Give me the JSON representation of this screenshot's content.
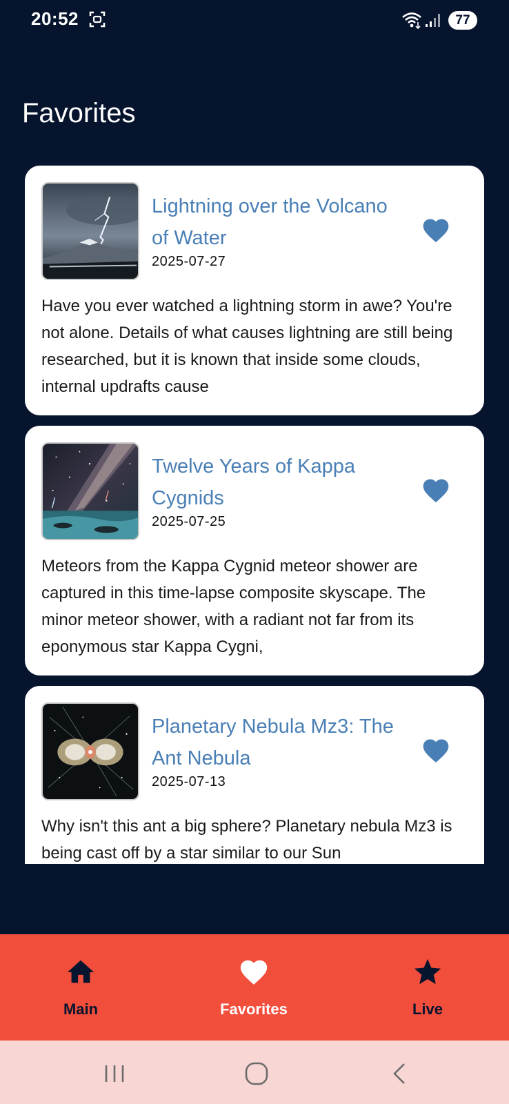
{
  "status_bar": {
    "time": "20:52",
    "battery": "77",
    "icons": [
      "screenshot-icon",
      "wifi-icon",
      "signal-icon"
    ]
  },
  "page": {
    "title": "Favorites"
  },
  "cards": [
    {
      "title": "Lightning over the Volcano of Water",
      "date": "2025-07-27",
      "description": "Have you ever watched a lightning storm in awe? You're not alone. Details of what causes lightning are still being researched, but it is known that inside some clouds, internal updrafts cause",
      "favorited": true
    },
    {
      "title": "Twelve Years of Kappa Cygnids",
      "date": "2025-07-25",
      "description": "Meteors from the Kappa Cygnid meteor shower are captured in this time-lapse composite skyscape. The minor meteor shower, with a radiant not far from its eponymous star Kappa Cygni,",
      "favorited": true
    },
    {
      "title": "Planetary Nebula Mz3: The Ant Nebula",
      "date": "2025-07-13",
      "description": "Why isn't this ant a big sphere?  Planetary nebula Mz3 is being cast off by a star similar to our Sun",
      "favorited": true
    }
  ],
  "bottom_nav": {
    "items": [
      {
        "label": "Main",
        "icon": "home-icon",
        "active": false
      },
      {
        "label": "Favorites",
        "icon": "heart-icon",
        "active": true
      },
      {
        "label": "Live",
        "icon": "star-icon",
        "active": false
      }
    ]
  },
  "system_nav": {
    "buttons": [
      "recents-icon",
      "home-circle-icon",
      "back-icon"
    ]
  },
  "colors": {
    "background": "#06142e",
    "card": "#ffffff",
    "title_accent": "#4a7fb5",
    "bottom_nav": "#f24e3c",
    "system_nav": "#f7d6d3"
  }
}
